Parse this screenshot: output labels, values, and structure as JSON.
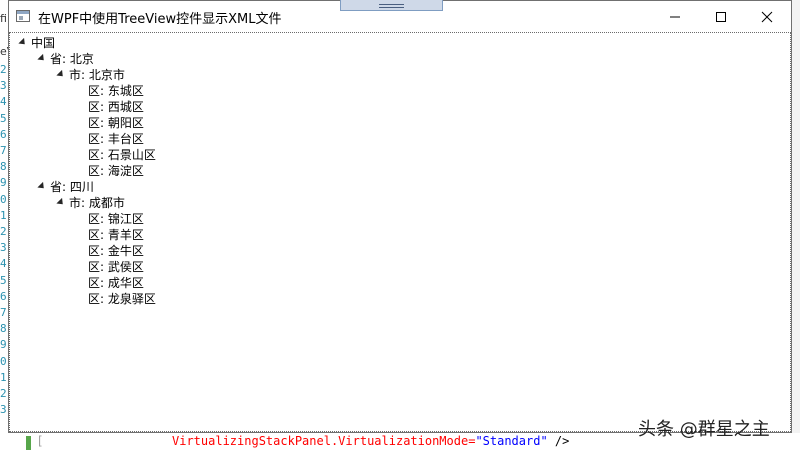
{
  "window": {
    "title": "在WPF中使用TreeView控件显示XML文件"
  },
  "background_editor": {
    "line_numbers": [
      "2",
      "3",
      "4",
      "5",
      "6",
      "7",
      "8",
      "9",
      "0",
      "1",
      "2",
      "3",
      "4",
      "5",
      "6",
      "7",
      "8",
      "9",
      "0",
      "1",
      "2",
      "3"
    ],
    "tab_glyphs": [
      "fi",
      "eV"
    ],
    "code_line": {
      "attr": "VirtualizingStackPanel.VirtualizationMode=",
      "value": "\"Standard\"",
      "tail": " />"
    }
  },
  "tree": {
    "root": "中国",
    "provinces": [
      {
        "label": "省: 北京",
        "cities": [
          {
            "label": "市: 北京市",
            "districts": [
              "区: 东城区",
              "区: 西城区",
              "区: 朝阳区",
              "区: 丰台区",
              "区: 石景山区",
              "区: 海淀区"
            ]
          }
        ]
      },
      {
        "label": "省: 四川",
        "cities": [
          {
            "label": "市: 成都市",
            "districts": [
              "区: 锦江区",
              "区: 青羊区",
              "区: 金牛区",
              "区: 武侯区",
              "区: 成华区",
              "区: 龙泉驿区"
            ]
          }
        ]
      }
    ]
  },
  "watermark": "头条 @群星之主"
}
